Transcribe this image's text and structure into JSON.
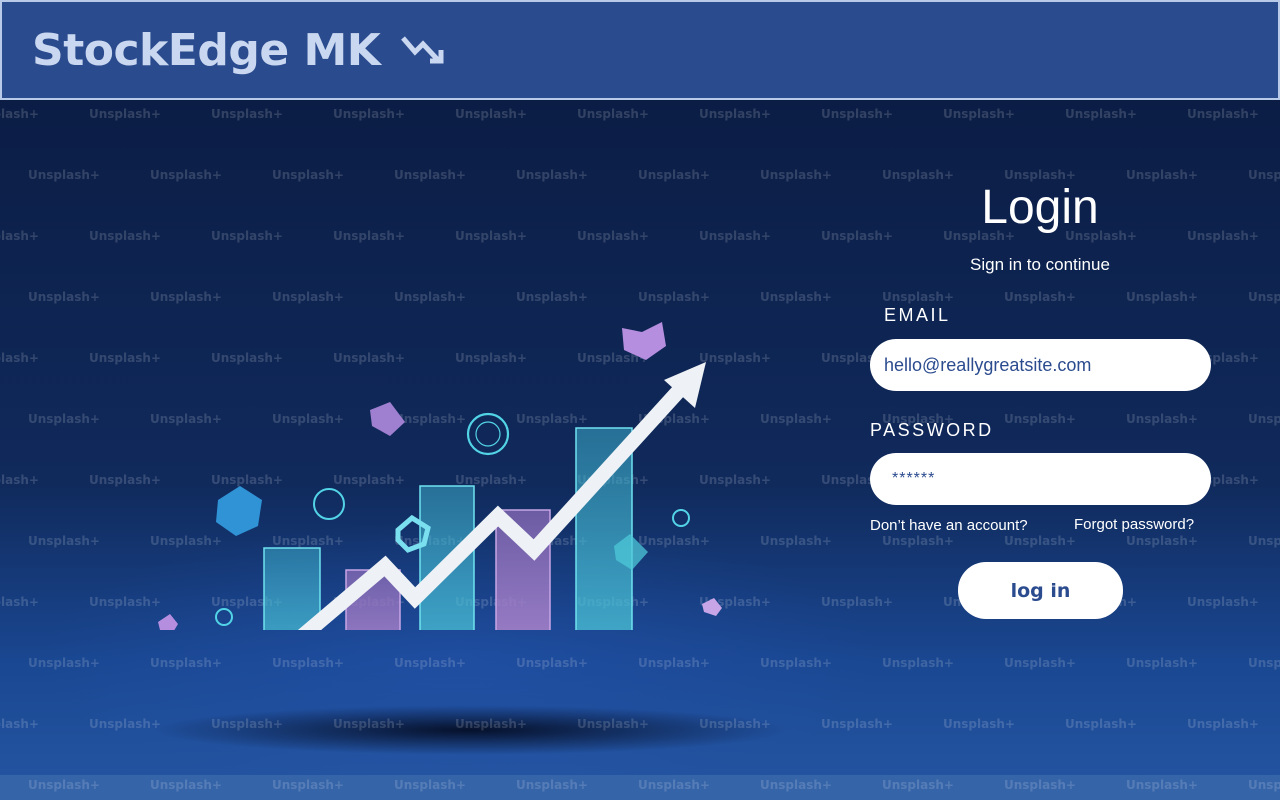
{
  "header": {
    "brand": "StockEdge MK",
    "brand_icon": "trend-down-icon",
    "bg_color": "#2b4b8f"
  },
  "hero": {
    "watermark": "Unsplash+",
    "illustration": "stock-growth-chart-illustration"
  },
  "login": {
    "title": "Login",
    "subtitle": "Sign in to continue",
    "email_label": "EMAIL",
    "email_value": "hello@reallygreatsite.com",
    "password_label": "PASSWORD",
    "password_value": "******",
    "signup_link": "Don’t have an account?",
    "forgot_link": "Forgot password?",
    "submit_label": "log in"
  },
  "colors": {
    "accent": "#2b4b8f",
    "background": "#0d2350",
    "field_bg": "#ffffff"
  }
}
